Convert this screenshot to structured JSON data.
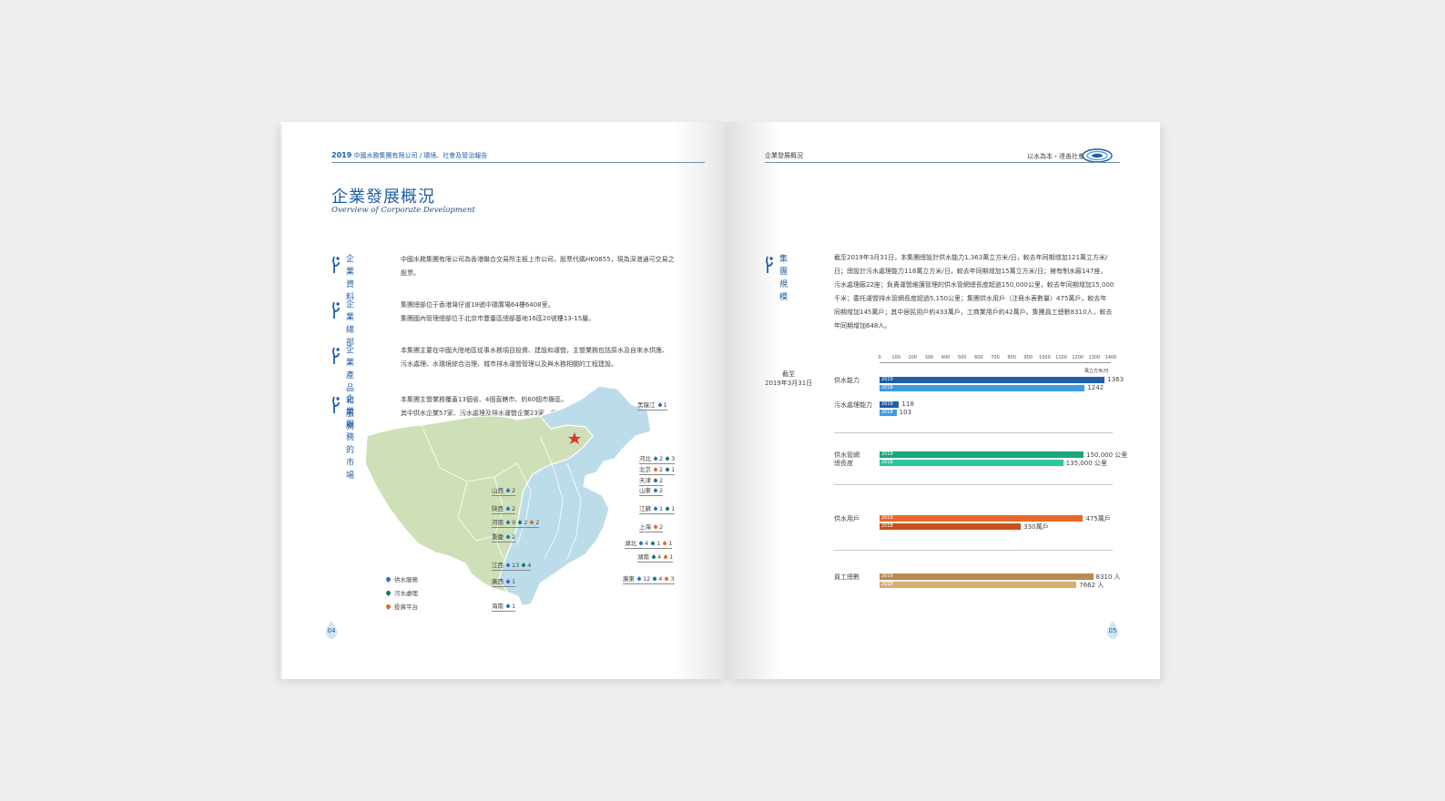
{
  "left_page": {
    "header": {
      "year": "2019",
      "text": "中國水務集團有限公司 / 環境、社會及管治報告"
    },
    "title": "企業發展概況",
    "subtitle": "Overview of Corporate Development",
    "sections": [
      {
        "label": [
          "企業",
          "資料"
        ],
        "text": [
          "中國水務集團有限公司為香港聯合交易所主板上市公司，股票代碼HK0855，現為深港通可交易之",
          "股票。"
        ]
      },
      {
        "label": [
          "企業",
          "總部"
        ],
        "text": [
          "集團總部位于香港灣仔道18號中環廣場64樓6408室。",
          "集團國內管理總部位于北京市豐臺區總部基地16區20號樓13-15層。"
        ]
      },
      {
        "label": [
          "企業產品",
          "和服務"
        ],
        "text": [
          "本集團主要在中國大陸地區從事水務項目投資、建設和運營，主營業務包括原水及自來水供應、",
          "污水處理、水環境綜合治理、城市排水運營管理以及與水務相關的工程建設。"
        ]
      },
      {
        "label": [
          "企業服務",
          "的市場"
        ],
        "text": [
          "本集團主營業務覆蓋13個省、4個直轄市、約60個市縣區。",
          "其中供水企業57家、污水處理及排水運營企業23家、投資平臺11家。"
        ]
      }
    ],
    "legend": [
      "供水服務",
      "污水處理",
      "投資平台"
    ],
    "provinces": [
      {
        "name": "黑龍江",
        "vals": [
          "1"
        ]
      },
      {
        "name": "河北",
        "vals": [
          "2",
          "3"
        ]
      },
      {
        "name": "北京",
        "vals": [
          "2",
          "1"
        ]
      },
      {
        "name": "天津",
        "vals": [
          "2"
        ]
      },
      {
        "name": "山東",
        "vals": [
          "2"
        ]
      },
      {
        "name": "山西",
        "vals": [
          "2"
        ]
      },
      {
        "name": "陝西",
        "vals": [
          "2"
        ]
      },
      {
        "name": "江蘇",
        "vals": [
          "1",
          "1"
        ]
      },
      {
        "name": "河南",
        "vals": [
          "9",
          "2",
          "2"
        ]
      },
      {
        "name": "上海",
        "vals": [
          "2"
        ]
      },
      {
        "name": "重慶",
        "vals": [
          "2"
        ]
      },
      {
        "name": "湖北",
        "vals": [
          "4",
          "1",
          "1"
        ]
      },
      {
        "name": "湖南",
        "vals": [
          "4",
          "1"
        ]
      },
      {
        "name": "江西",
        "vals": [
          "13",
          "4"
        ]
      },
      {
        "name": "廣東",
        "vals": [
          "12",
          "4",
          "3"
        ]
      },
      {
        "name": "廣西",
        "vals": [
          "1"
        ]
      },
      {
        "name": "海南",
        "vals": [
          "1"
        ]
      }
    ],
    "page_number": "04"
  },
  "right_page": {
    "header": {
      "section": "企業發展概況",
      "slogan": "以水為本・達善社會"
    },
    "section_label": [
      "集團",
      "規模"
    ],
    "paragraph": [
      "截至2019年3月31日，本集團總設計供水能力1,363萬立方米/日，較去年同期增加121萬立方米/",
      "日；總設計污水處理能力118萬立方米/日，較去年同期增加15萬立方米/日；擁有制水廠147座，",
      "污水處理廠22座；負責運營維護管理的供水管網總長度超過150,000公里，較去年同期增加15,000",
      "千米；委托運營排水管網長度超過5,150公里；集團供水用戶（注冊水表數量）475萬戶，較去年",
      "同期增加145萬戶；其中居民用戶約433萬戶，工商業用戶約42萬戶。集團員工總數8310人，較去",
      "年同期增加648人。"
    ],
    "as_of": [
      "截至",
      "2019年3月31日"
    ],
    "unit": "萬立方米/日",
    "page_number": "05"
  },
  "chart_data": {
    "type": "bar",
    "orientation": "horizontal",
    "axis_ticks": [
      "0",
      "100",
      "200",
      "300",
      "400",
      "500",
      "600",
      "700",
      "800",
      "900",
      "1000",
      "1100",
      "1200",
      "1300",
      "1400"
    ],
    "xlim": [
      0,
      1400
    ],
    "series_years": [
      "2019",
      "2018"
    ],
    "groups": [
      {
        "label": [
          "供水能力"
        ],
        "values": [
          1363,
          1242
        ],
        "labels": [
          "1363",
          "1242"
        ],
        "colors": [
          "#1f5ea8",
          "#3f9be0"
        ],
        "max": 1400
      },
      {
        "label": [
          "污水處理能力"
        ],
        "values": [
          118,
          103
        ],
        "labels": [
          "118",
          "103"
        ],
        "colors": [
          "#1f5ea8",
          "#3f9be0"
        ],
        "max": 1400
      },
      {
        "label": [
          "供水管網",
          "總長度"
        ],
        "values": [
          150000,
          135000
        ],
        "labels": [
          "150,000 公里",
          "135,000 公里"
        ],
        "colors": [
          "#1aa77a",
          "#2ec4a0"
        ],
        "max": 170000
      },
      {
        "label": [
          "供水用戶"
        ],
        "values": [
          475,
          330
        ],
        "labels": [
          "475萬戶",
          "330萬戶"
        ],
        "colors": [
          "#e56a28",
          "#c85318"
        ],
        "max": 540
      },
      {
        "label": [
          "員工總數"
        ],
        "values": [
          8310,
          7662
        ],
        "labels": [
          "8310 人",
          "7662 人"
        ],
        "colors": [
          "#b98a52",
          "#d9ac72"
        ],
        "max": 9000
      }
    ]
  }
}
